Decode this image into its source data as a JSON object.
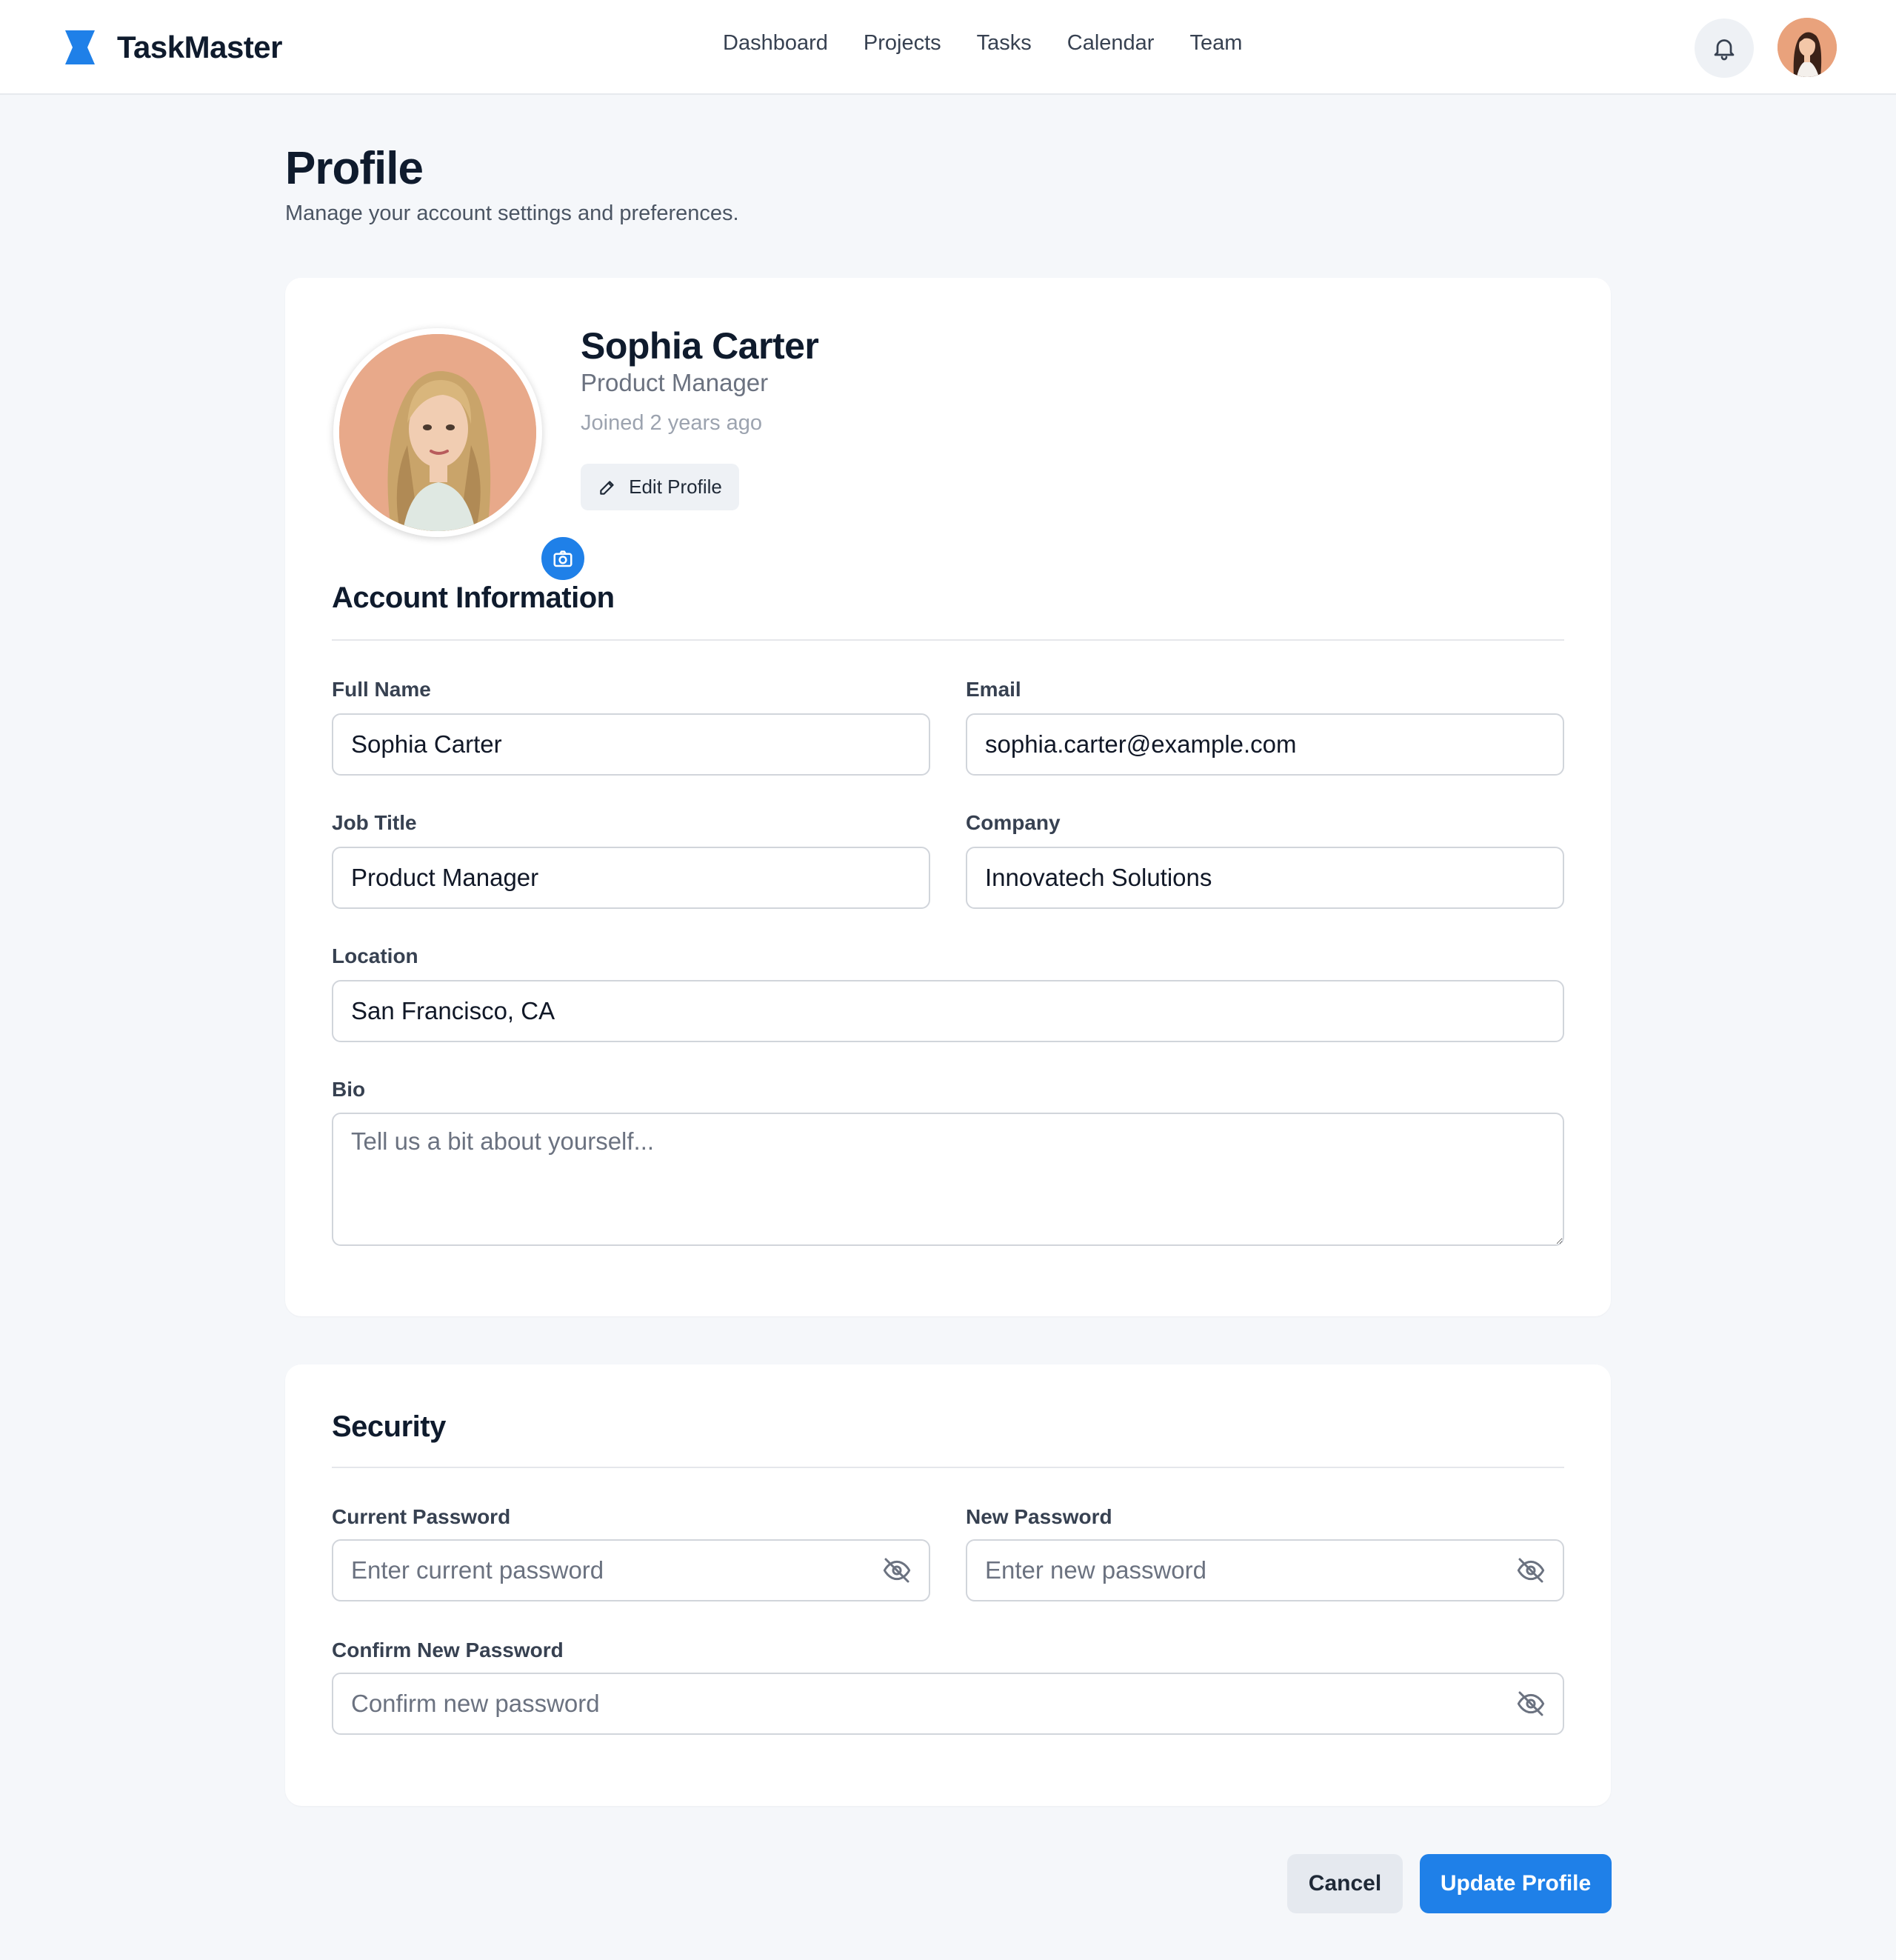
{
  "header": {
    "brand_name": "TaskMaster",
    "nav": [
      "Dashboard",
      "Projects",
      "Tasks",
      "Calendar",
      "Team"
    ],
    "icons": {
      "logo": "hourglass-logo-icon",
      "notifications": "bell-icon",
      "avatar": "user-avatar"
    }
  },
  "page": {
    "title": "Profile",
    "subtitle": "Manage your account settings and preferences."
  },
  "profile": {
    "name": "Sophia Carter",
    "role": "Product Manager",
    "joined": "Joined 2 years ago",
    "edit_label": "Edit Profile"
  },
  "account": {
    "title": "Account Information",
    "full_name": {
      "label": "Full Name",
      "value": "Sophia Carter"
    },
    "email": {
      "label": "Email",
      "value": "sophia.carter@example.com"
    },
    "job_title": {
      "label": "Job Title",
      "value": "Product Manager"
    },
    "company": {
      "label": "Company",
      "value": "Innovatech Solutions"
    },
    "location": {
      "label": "Location",
      "value": "San Francisco, CA"
    },
    "bio": {
      "label": "Bio",
      "placeholder": "Tell us a bit about yourself..."
    }
  },
  "security": {
    "title": "Security",
    "current_password": {
      "label": "Current Password",
      "placeholder": "Enter current password"
    },
    "new_password": {
      "label": "New Password",
      "placeholder": "Enter new password"
    },
    "confirm_password": {
      "label": "Confirm New Password",
      "placeholder": "Confirm new password"
    }
  },
  "actions": {
    "cancel": "Cancel",
    "update": "Update Profile"
  },
  "colors": {
    "accent": "#1f80e8",
    "text_dark": "#0f1b2d",
    "muted": "#6b7280",
    "background": "#f5f7fa"
  }
}
